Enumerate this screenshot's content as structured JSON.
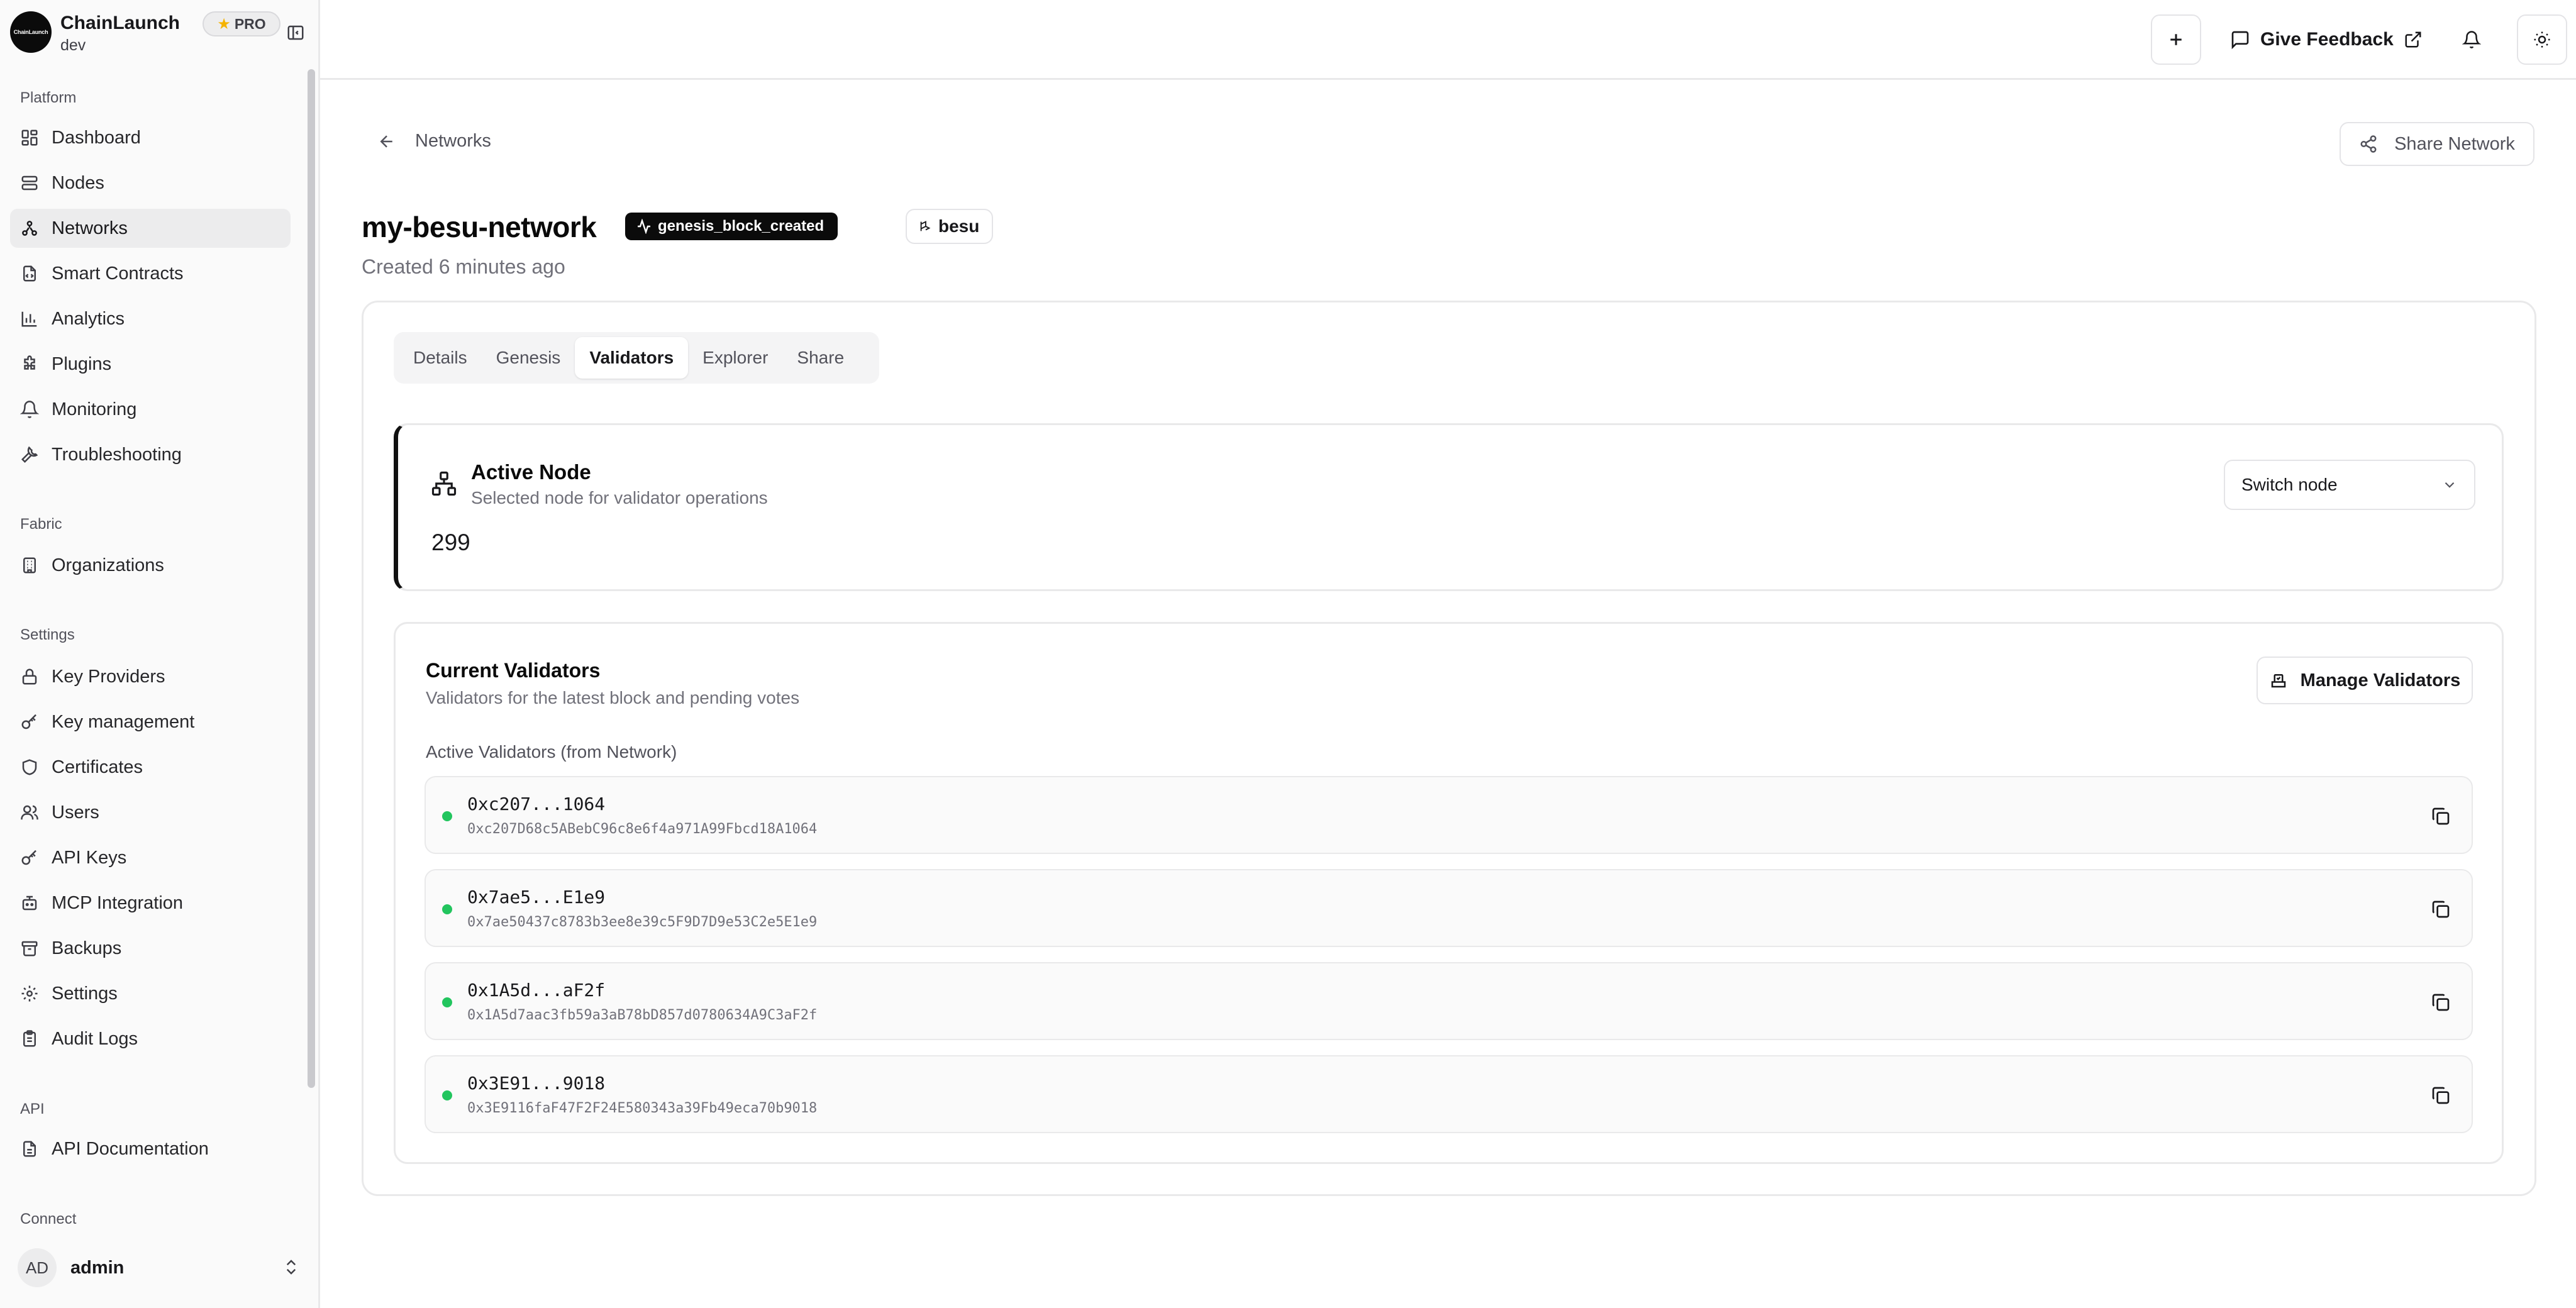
{
  "brand": {
    "name": "ChainLaunch",
    "env": "dev",
    "logo_text": "ChainLaunch",
    "badge": "PRO"
  },
  "sidebar": {
    "groups": {
      "platform": "Platform",
      "fabric": "Fabric",
      "settings": "Settings",
      "api": "API",
      "connect": "Connect"
    },
    "items": {
      "dashboard": "Dashboard",
      "nodes": "Nodes",
      "networks": "Networks",
      "smart_contracts": "Smart Contracts",
      "analytics": "Analytics",
      "plugins": "Plugins",
      "monitoring": "Monitoring",
      "troubleshooting": "Troubleshooting",
      "organizations": "Organizations",
      "key_providers": "Key Providers",
      "key_management": "Key management",
      "certificates": "Certificates",
      "users": "Users",
      "api_keys": "API Keys",
      "mcp_integration": "MCP Integration",
      "backups": "Backups",
      "settings": "Settings",
      "audit_logs": "Audit Logs",
      "api_documentation": "API Documentation"
    },
    "user": {
      "initials": "AD",
      "name": "admin"
    }
  },
  "header": {
    "feedback_label": "Give Feedback"
  },
  "page": {
    "back_label": "Networks",
    "share_label": "Share Network",
    "title": "my-besu-network",
    "status": "genesis_block_created",
    "chain": "besu",
    "created": "Created 6 minutes ago",
    "tabs": [
      "Details",
      "Genesis",
      "Validators",
      "Explorer",
      "Share"
    ],
    "active_tab": "Validators"
  },
  "active_node": {
    "title": "Active Node",
    "subtitle": "Selected node for validator operations",
    "value": "299",
    "switch_label": "Switch node"
  },
  "validators": {
    "title": "Current Validators",
    "subtitle": "Validators for the latest block and pending votes",
    "manage_label": "Manage Validators",
    "section_label": "Active Validators (from Network)",
    "rows": [
      {
        "short": "0xc207...1064",
        "full": "0xc207D68c5ABebC96c8e6f4a971A99Fbcd18A1064"
      },
      {
        "short": "0x7ae5...E1e9",
        "full": "0x7ae50437c8783b3ee8e39c5F9D7D9e53C2e5E1e9"
      },
      {
        "short": "0x1A5d...aF2f",
        "full": "0x1A5d7aac3fb59a3aB78bD857d0780634A9C3aF2f"
      },
      {
        "short": "0x3E91...9018",
        "full": "0x3E9116faF47F2F24E580343a39Fb49eca70b9018"
      }
    ]
  },
  "colors": {
    "status_dot": "#22c55e",
    "badge_bg": "#0b0b0b",
    "pro_star": "#f5b301"
  }
}
